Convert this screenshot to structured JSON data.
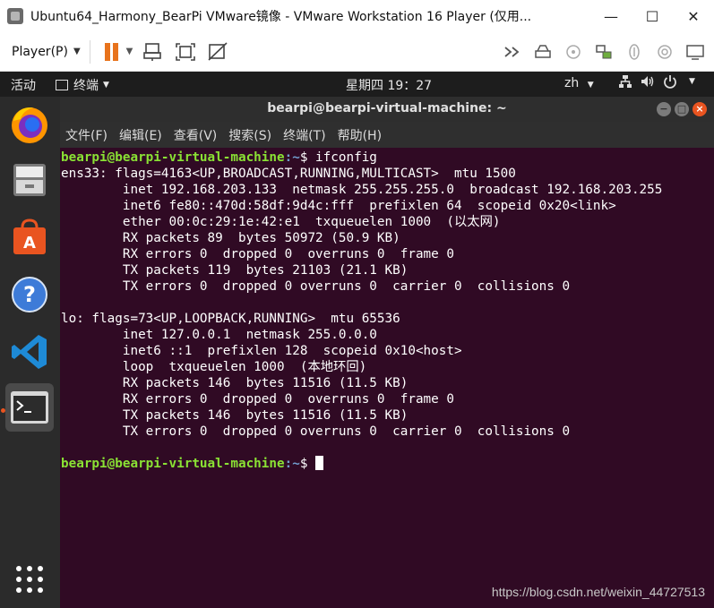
{
  "window": {
    "title": "Ubuntu64_Harmony_BearPi VMware镜像 - VMware Workstation 16 Player (仅用...",
    "minimize": "—",
    "maximize": "☐",
    "close": "✕"
  },
  "toolbar": {
    "player_label": "Player(P)",
    "icons_left": [
      "pause-icon",
      "send-keys-icon",
      "fit-window-icon",
      "unity-icon"
    ],
    "icons_right": [
      "double-arrow-icon",
      "hdd-icon",
      "cd-icon",
      "network-icon",
      "usb-icon",
      "audio-icon",
      "screen-icon"
    ]
  },
  "ubuntu_topbar": {
    "activities": "活动",
    "app_menu": "终端",
    "clock": "星期四 19：27",
    "language": "zh"
  },
  "dock": {
    "apps": [
      "firefox",
      "files",
      "software",
      "help",
      "vscode",
      "terminal"
    ],
    "show_apps": "show-apps"
  },
  "terminal": {
    "title": "bearpi@bearpi-virtual-machine: ~",
    "menus": [
      "文件(F)",
      "编辑(E)",
      "查看(V)",
      "搜索(S)",
      "终端(T)",
      "帮助(H)"
    ],
    "prompt_user": "bearpi@bearpi-virtual-machine",
    "prompt_path": ":~",
    "command": "$ ifconfig",
    "output": [
      "ens33: flags=4163<UP,BROADCAST,RUNNING,MULTICAST>  mtu 1500",
      "        inet 192.168.203.133  netmask 255.255.255.0  broadcast 192.168.203.255",
      "        inet6 fe80::470d:58df:9d4c:fff  prefixlen 64  scopeid 0x20<link>",
      "        ether 00:0c:29:1e:42:e1  txqueuelen 1000  (以太网)",
      "        RX packets 89  bytes 50972 (50.9 KB)",
      "        RX errors 0  dropped 0  overruns 0  frame 0",
      "        TX packets 119  bytes 21103 (21.1 KB)",
      "        TX errors 0  dropped 0 overruns 0  carrier 0  collisions 0",
      "",
      "lo: flags=73<UP,LOOPBACK,RUNNING>  mtu 65536",
      "        inet 127.0.0.1  netmask 255.0.0.0",
      "        inet6 ::1  prefixlen 128  scopeid 0x10<host>",
      "        loop  txqueuelen 1000  (本地环回)",
      "        RX packets 146  bytes 11516 (11.5 KB)",
      "        RX errors 0  dropped 0  overruns 0  frame 0",
      "        TX packets 146  bytes 11516 (11.5 KB)",
      "        TX errors 0  dropped 0 overruns 0  carrier 0  collisions 0",
      ""
    ],
    "final_prompt_user": "bearpi@bearpi-virtual-machine",
    "final_prompt_path": ":~",
    "final_prompt_symbol": "$ "
  },
  "watermark": "https://blog.csdn.net/weixin_44727513",
  "colors": {
    "terminal_bg": "#300a24",
    "prompt_user": "#8ae234",
    "prompt_path": "#729fcf",
    "accent": "#e95420",
    "pause_orange": "#e8731c"
  }
}
